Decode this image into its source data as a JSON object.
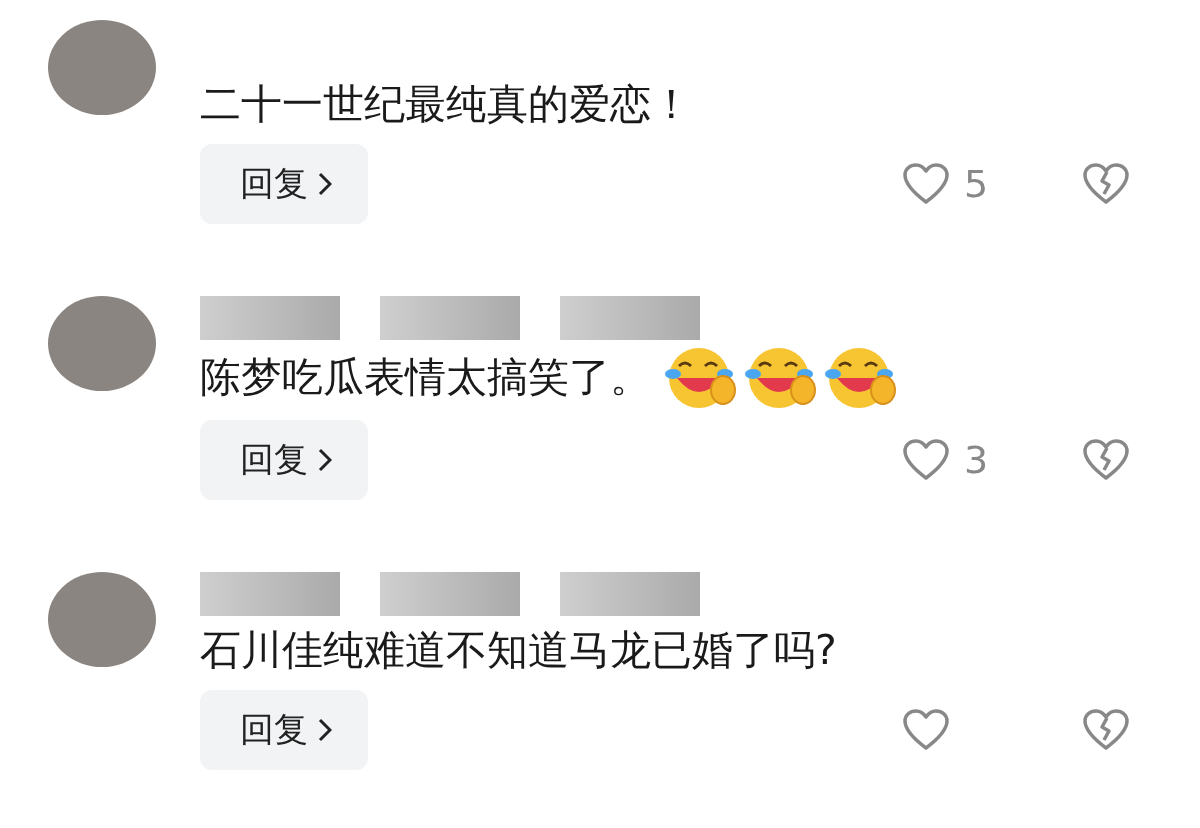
{
  "comments": [
    {
      "text": "二十一世纪最纯真的爱恋！",
      "reply": "回复",
      "likes": "5"
    },
    {
      "username": {
        "kind": "blurred"
      },
      "text": "陈梦吃瓜表情太搞笑了。",
      "stickers": [
        {
          "kind": "laughing"
        },
        {
          "kind": "laughing"
        },
        {
          "kind": "laughing"
        }
      ],
      "reply": "回复",
      "likes": "3"
    },
    {
      "username": {
        "kind": "blurred"
      },
      "text": "石川佳纯难道不知道马龙已婚了吗?",
      "reply": "回复"
    }
  ]
}
